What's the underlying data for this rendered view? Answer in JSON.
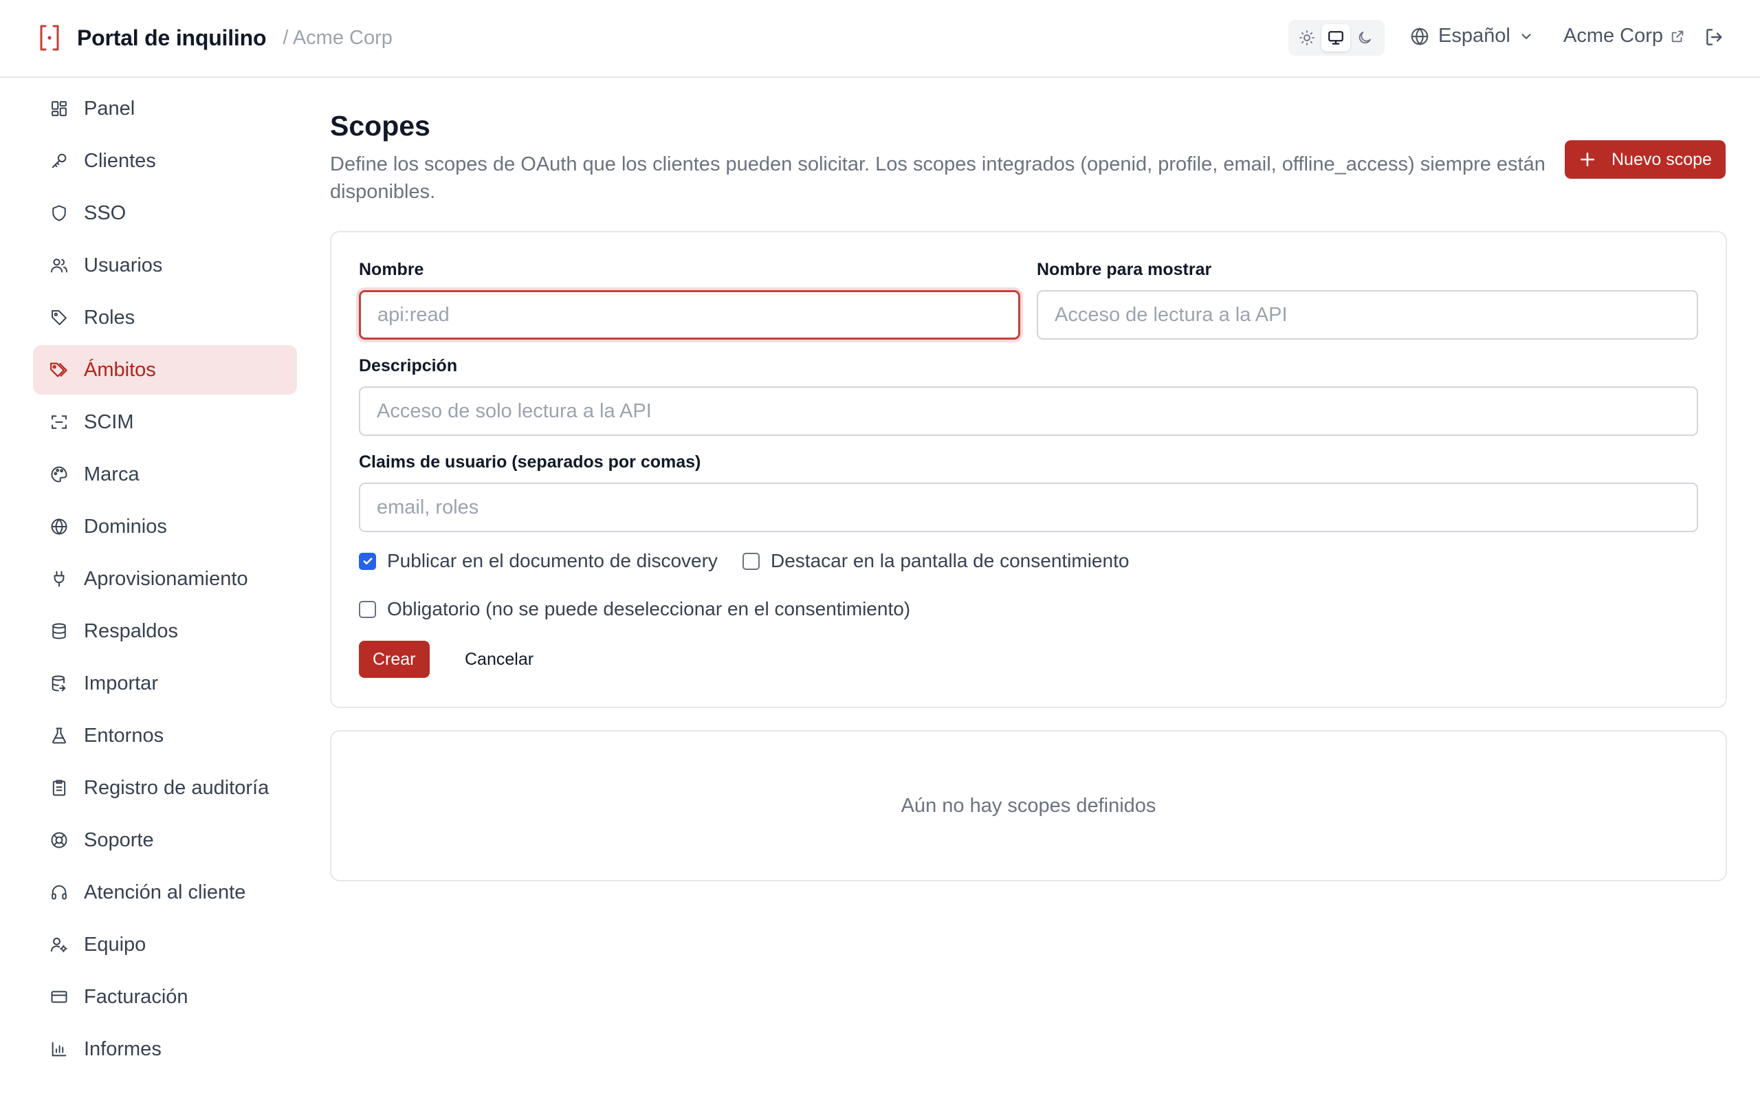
{
  "header": {
    "app_title": "Portal de inquilino",
    "breadcrumb": "/ Acme Corp",
    "language": "Español",
    "tenant_name": "Acme Corp",
    "icons": [
      "bracket-logo-icon",
      "sun-icon",
      "monitor-icon",
      "moon-icon",
      "globe-icon",
      "chevron-down-icon",
      "external-link-icon",
      "logout-icon"
    ],
    "active_theme": "system"
  },
  "sidebar": {
    "active": "Ámbitos",
    "items": [
      {
        "label": "Panel",
        "icon": "layout-grid-icon"
      },
      {
        "label": "Clientes",
        "icon": "key-icon"
      },
      {
        "label": "SSO",
        "icon": "shield-icon"
      },
      {
        "label": "Usuarios",
        "icon": "users-icon"
      },
      {
        "label": "Roles",
        "icon": "tag-icon"
      },
      {
        "label": "Ámbitos",
        "icon": "tags-icon"
      },
      {
        "label": "SCIM",
        "icon": "scan-icon"
      },
      {
        "label": "Marca",
        "icon": "palette-icon"
      },
      {
        "label": "Dominios",
        "icon": "globe-icon"
      },
      {
        "label": "Aprovisionamiento",
        "icon": "plug-icon"
      },
      {
        "label": "Respaldos",
        "icon": "database-icon"
      },
      {
        "label": "Importar",
        "icon": "database-import-icon"
      },
      {
        "label": "Entornos",
        "icon": "flask-icon"
      },
      {
        "label": "Registro de auditoría",
        "icon": "clipboard-list-icon"
      },
      {
        "label": "Soporte",
        "icon": "life-buoy-icon"
      },
      {
        "label": "Atención al cliente",
        "icon": "headphones-icon"
      },
      {
        "label": "Equipo",
        "icon": "user-cog-icon"
      },
      {
        "label": "Facturación",
        "icon": "credit-card-icon"
      },
      {
        "label": "Informes",
        "icon": "bar-chart-icon"
      }
    ]
  },
  "page": {
    "title": "Scopes",
    "description": "Define los scopes de OAuth que los clientes pueden solicitar. Los scopes integrados (openid, profile, email, offline_access) siempre están disponibles.",
    "new_button": "Nuevo scope"
  },
  "form": {
    "name_label": "Nombre",
    "name_value": "",
    "name_placeholder": "api:read",
    "display_label": "Nombre para mostrar",
    "display_value": "",
    "display_placeholder": "Acceso de lectura a la API",
    "description_label": "Descripción",
    "description_value": "",
    "description_placeholder": "Acceso de solo lectura a la API",
    "claims_label": "Claims de usuario (separados por comas)",
    "claims_value": "",
    "claims_placeholder": "email, roles",
    "checkboxes": [
      {
        "label": "Publicar en el documento de discovery",
        "checked": true
      },
      {
        "label": "Destacar en la pantalla de consentimiento",
        "checked": false
      },
      {
        "label": "Obligatorio (no se puede deseleccionar en el consentimiento)",
        "checked": false
      }
    ],
    "create_label": "Crear",
    "cancel_label": "Cancelar"
  },
  "empty_state": {
    "message": "Aún no hay scopes definidos"
  },
  "colors": {
    "accent": "#b82c26",
    "active_nav_bg": "#f8e4e4",
    "checkbox": "#2563eb"
  }
}
